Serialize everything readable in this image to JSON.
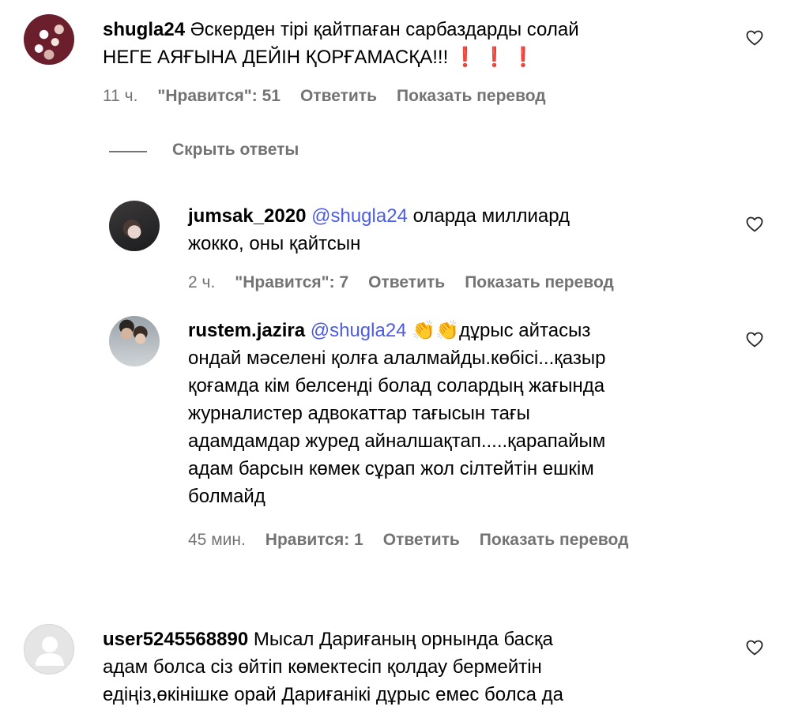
{
  "comments": [
    {
      "username": "shugla24",
      "text_line1": "Әскерден тірі қайтпаған сарбаздарды солай",
      "text_line2": "НЕГЕ АЯҒЫНА ДЕЙІН ҚОРҒАМАСҚА!!!",
      "exclamation_emojis": "❗ ❗ ❗",
      "time": "11 ч.",
      "likes": "\"Нравится\": 51",
      "reply": "Ответить",
      "translate": "Показать перевод"
    }
  ],
  "hide_replies": "Скрыть ответы",
  "replies": [
    {
      "username": "jumsak_2020",
      "mention": "@shugla24",
      "text_line1_rest": "оларда миллиард",
      "text_line2": "жокко, оны қайтсын",
      "time": "2 ч.",
      "likes": "\"Нравится\": 7",
      "reply": "Ответить",
      "translate": "Показать перевод"
    },
    {
      "username": "rustem.jazira",
      "mention": "@shugla24",
      "emojis": "👏👏",
      "text_line1_rest": "дұрыс айтасыз",
      "lines": [
        "ондай мәселені қолға алалмайды.көбісі...қазыр",
        "қоғамда кім белсенді болад солардың жағында",
        "журналистер адвокаттар тағысын тағы",
        "адамдамдар журед айналшақтап.....қарапайым",
        "адам барсын көмек сұрап жол сілтейтін ешкім",
        "болмайд"
      ],
      "time": "45 мин.",
      "likes": "Нравится: 1",
      "reply": "Ответить",
      "translate": "Показать перевод"
    }
  ],
  "last_comment": {
    "username": "user5245568890",
    "text_line1_rest": "Мысал Дариғаның орнында басқа",
    "text_line2": "адам болса сіз өйтіп көмектесіп қолдау бермейтін",
    "text_line3": "едіңіз,өкінішке орай Дариғанікі дұрыс емес болса да"
  },
  "icons": {
    "like": "heart-outline-icon",
    "default_avatar": "person-silhouette-icon"
  },
  "colors": {
    "mention": "#4c5ce5",
    "meta_gray": "#737373",
    "exclamation": "#e0201b"
  }
}
